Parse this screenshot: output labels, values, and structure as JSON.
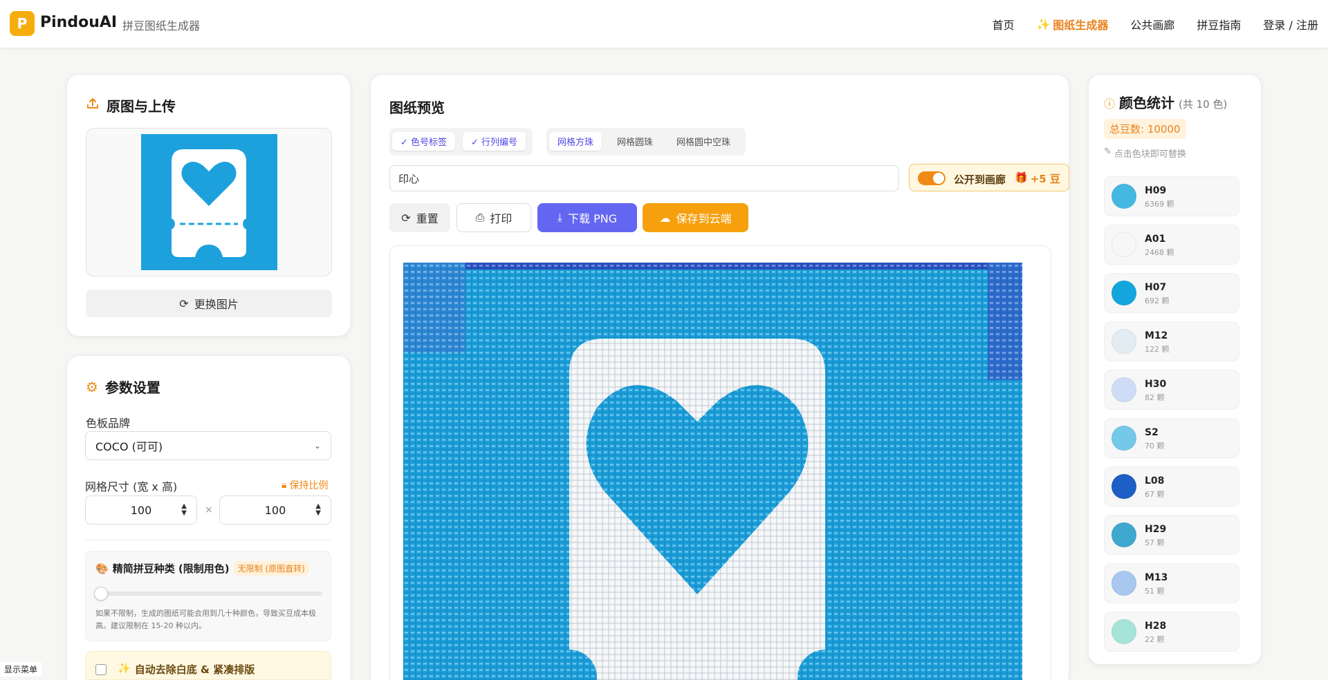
{
  "header": {
    "logo_letter": "P",
    "brand": "PindouAI",
    "subtitle": "拼豆图纸生成器",
    "nav": [
      "首页",
      "图纸生成器",
      "公共画廊",
      "拼豆指南",
      "登录 / 注册"
    ]
  },
  "upload": {
    "title": "原图与上传",
    "change_button": "更换图片"
  },
  "params": {
    "title": "参数设置",
    "brand_label": "色板品牌",
    "brand_value": "COCO (可可)",
    "grid_label": "网格尺寸 (宽 x 高)",
    "keep_ratio": "保持比例",
    "width": "100",
    "height": "100",
    "times": "×",
    "simplify_title": "精简拼豆种类 (限制用色)",
    "simplify_badge": "无限制 (原图直转)",
    "simplify_level": 0,
    "simplify_note": "如果不限制，生成的图纸可能会用到几十种颜色，导致买豆成本极高。建议限制在 15-20 种以内。",
    "auto_remove": "自动去除白底 & 紧凑排版"
  },
  "preview": {
    "title": "图纸预览",
    "toggle_color_code": "色号标签",
    "toggle_row_col": "行列编号",
    "modes": [
      "网格方珠",
      "网格圆珠",
      "网格圆中空珠"
    ],
    "name_value": "印心",
    "publish_label": "公开到画廊",
    "publish_reward": "+5 豆",
    "buttons": {
      "reset": "重置",
      "print": "打印",
      "download": "下载 PNG",
      "save": "保存到云端"
    }
  },
  "stats": {
    "title": "颜色统计",
    "count_label": "(共 10 色)",
    "total": "总豆数: 10000",
    "hint": "点击色块即可替换",
    "colors": [
      {
        "code": "H09",
        "count": "6369 颗",
        "hex": "#45b8e2"
      },
      {
        "code": "A01",
        "count": "2468 颗",
        "hex": "#f7f7f7"
      },
      {
        "code": "H07",
        "count": "692 颗",
        "hex": "#13a6dc"
      },
      {
        "code": "M12",
        "count": "122 颗",
        "hex": "#e2ecf2"
      },
      {
        "code": "H30",
        "count": "82 颗",
        "hex": "#cfdcf6"
      },
      {
        "code": "S2",
        "count": "70 颗",
        "hex": "#74c9e8"
      },
      {
        "code": "L08",
        "count": "67 颗",
        "hex": "#1d5fc4"
      },
      {
        "code": "H29",
        "count": "57 颗",
        "hex": "#3fa8cf"
      },
      {
        "code": "M13",
        "count": "51 颗",
        "hex": "#a9c8ef"
      },
      {
        "code": "H28",
        "count": "22 颗",
        "hex": "#a6e4da"
      }
    ]
  },
  "footer_menu": "显示菜单",
  "accent": {
    "orange": "#f08a16",
    "purple": "#6366f1",
    "blue_bg": "#1ca1dc"
  }
}
